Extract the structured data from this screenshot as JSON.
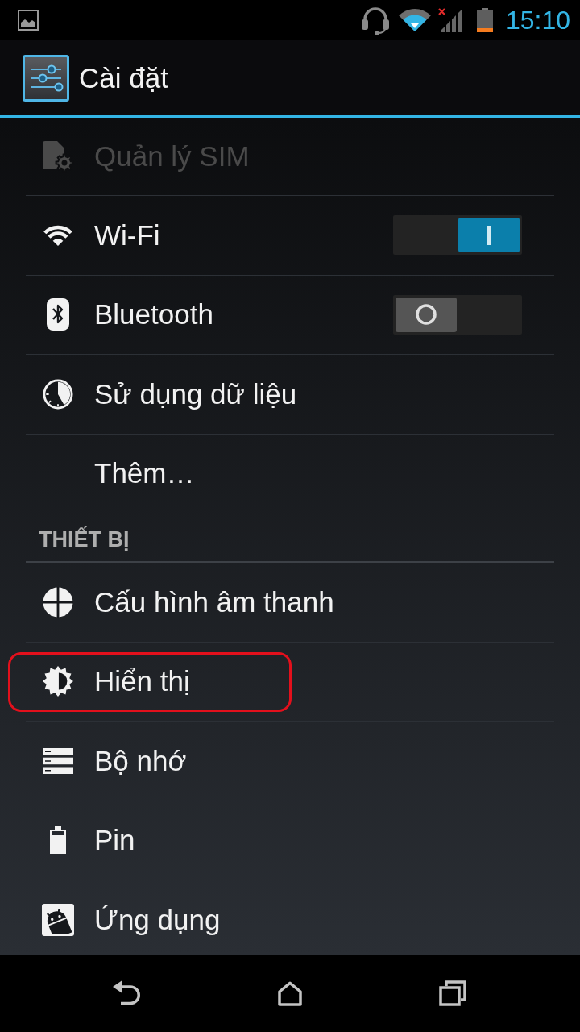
{
  "status_bar": {
    "time": "15:10"
  },
  "action_bar": {
    "title": "Cài đặt"
  },
  "sections": [
    {
      "items": [
        {
          "label": "Quản lý SIM",
          "kind": "link",
          "disabled": true,
          "highlighted": false
        },
        {
          "label": "Wi-Fi",
          "kind": "toggle",
          "on": true,
          "disabled": false,
          "highlighted": false
        },
        {
          "label": "Bluetooth",
          "kind": "toggle",
          "on": false,
          "disabled": false,
          "highlighted": false
        },
        {
          "label": "Sử dụng dữ liệu",
          "kind": "link",
          "disabled": false,
          "highlighted": false
        },
        {
          "label": "Thêm…",
          "kind": "link",
          "disabled": false,
          "highlighted": false
        }
      ]
    },
    {
      "header": "THIẾT BỊ",
      "items": [
        {
          "label": "Cấu hình âm thanh",
          "kind": "link",
          "disabled": false,
          "highlighted": false
        },
        {
          "label": "Hiển thị",
          "kind": "link",
          "disabled": false,
          "highlighted": true
        },
        {
          "label": "Bộ nhớ",
          "kind": "link",
          "disabled": false,
          "highlighted": false
        },
        {
          "label": "Pin",
          "kind": "link",
          "disabled": false,
          "highlighted": false
        },
        {
          "label": "Ứng dụng",
          "kind": "link",
          "disabled": false,
          "highlighted": false
        }
      ]
    }
  ]
}
